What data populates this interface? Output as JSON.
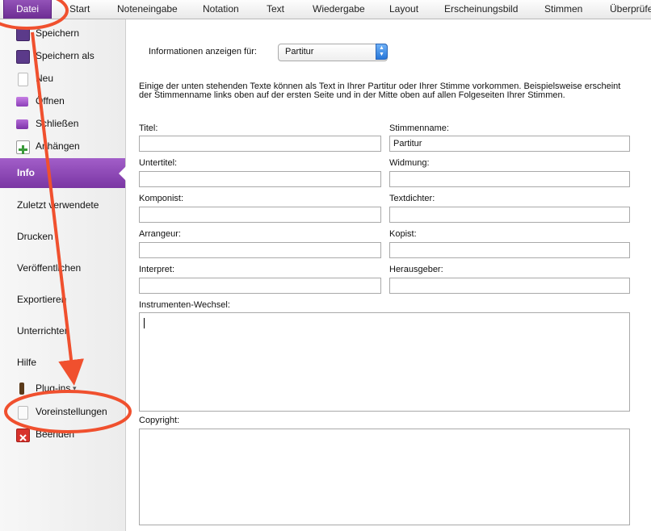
{
  "ribbon": {
    "tabs": [
      "Datei",
      "Start",
      "Noteneingabe",
      "Notation",
      "Text",
      "Wiedergabe",
      "Layout",
      "Erscheinungsbild",
      "Stimmen",
      "Überprüfe"
    ],
    "active_index": 0
  },
  "sidebar": {
    "small_items": [
      {
        "label": "Speichern",
        "icon": "save-icon"
      },
      {
        "label": "Speichern als",
        "icon": "save-as-icon"
      },
      {
        "label": "Neu",
        "icon": "new-document-icon"
      },
      {
        "label": "Öffnen",
        "icon": "open-folder-icon"
      },
      {
        "label": "Schließen",
        "icon": "close-folder-icon"
      },
      {
        "label": "Anhängen",
        "icon": "append-icon"
      }
    ],
    "info_label": "Info",
    "big_items": [
      "Zuletzt verwendete",
      "Drucken",
      "Veröffentlichen",
      "Exportieren",
      "Unterrichten",
      "Hilfe"
    ],
    "plugins_label": "Plug-ins",
    "plugins_arrow": "▾",
    "preferences_label": "Voreinstellungen",
    "quit_label": "Beenden"
  },
  "main": {
    "show_for_label": "Informationen anzeigen für:",
    "show_for_value": "Partitur",
    "description": "Einige der unten stehenden Texte können als Text in Ihrer Partitur oder Ihrer Stimme vorkommen. Beispielsweise erscheint der Stimmenname links oben auf der ersten Seite und in der Mitte oben auf allen Folgeseiten Ihrer Stimmen.",
    "fields": {
      "titel": {
        "label": "Titel:",
        "value": ""
      },
      "stimmenname": {
        "label": "Stimmenname:",
        "value": "Partitur"
      },
      "untertitel": {
        "label": "Untertitel:",
        "value": ""
      },
      "widmung": {
        "label": "Widmung:",
        "value": ""
      },
      "komponist": {
        "label": "Komponist:",
        "value": ""
      },
      "textdichter": {
        "label": "Textdichter:",
        "value": ""
      },
      "arrangeur": {
        "label": "Arrangeur:",
        "value": ""
      },
      "kopist": {
        "label": "Kopist:",
        "value": ""
      },
      "interpret": {
        "label": "Interpret:",
        "value": ""
      },
      "herausgeber": {
        "label": "Herausgeber:",
        "value": ""
      },
      "instrumenten_wechsel": {
        "label": "Instrumenten-Wechsel:",
        "value": ""
      },
      "copyright": {
        "label": "Copyright:",
        "value": ""
      }
    }
  },
  "colors": {
    "accent_purple": "#7a36a3",
    "annotation_red": "#f0502e"
  }
}
